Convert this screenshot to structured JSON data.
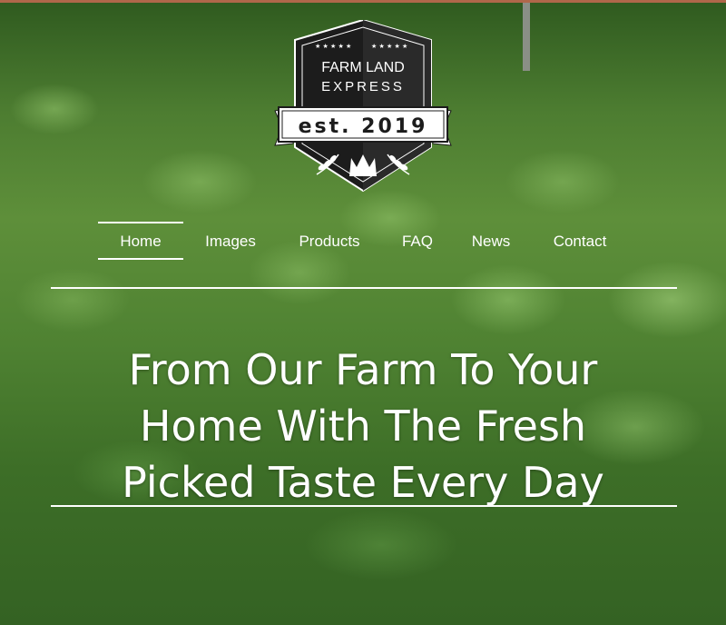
{
  "logo": {
    "line1": "FARM LAND",
    "line2": "EXPRESS",
    "ribbon": "est. 2019",
    "icons": [
      "star-icon",
      "wheat-icon",
      "crown-icon"
    ]
  },
  "nav": {
    "items": [
      {
        "label": "Home",
        "active": true
      },
      {
        "label": "Images",
        "active": false
      },
      {
        "label": "Products",
        "active": false
      },
      {
        "label": "FAQ",
        "active": false
      },
      {
        "label": "News",
        "active": false
      },
      {
        "label": "Contact",
        "active": false
      }
    ]
  },
  "hero": {
    "lines": [
      "From Our Farm To Your",
      "Home With The Fresh",
      "Picked Taste Every Day"
    ]
  },
  "colors": {
    "text": "#ffffff",
    "badge_dark": "#1c1c1c",
    "badge_light": "#ffffff"
  }
}
